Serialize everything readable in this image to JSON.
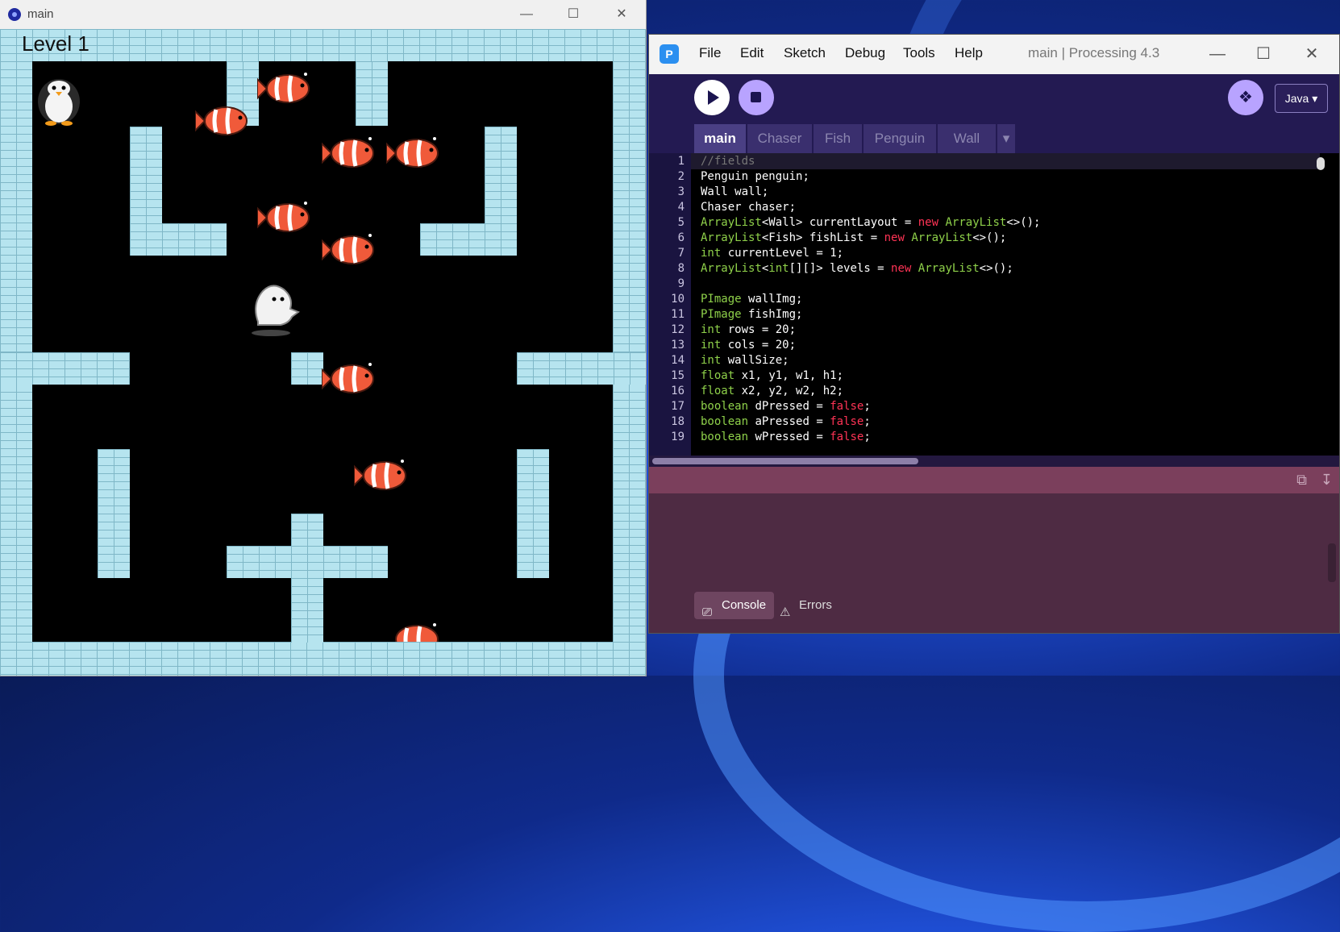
{
  "game": {
    "window_title": "main",
    "level_label": "Level 1"
  },
  "ide": {
    "window_title": "main | Processing 4.3",
    "menu": [
      "File",
      "Edit",
      "Sketch",
      "Debug",
      "Tools",
      "Help"
    ],
    "mode": "Java ▾",
    "tabs": [
      "main",
      "Chaser",
      "Fish",
      "Penguin",
      "Wall"
    ],
    "active_tab": "main",
    "tab_menu_glyph": "▾",
    "code_lines": [
      "//fields",
      "Penguin penguin;",
      "Wall wall;",
      "Chaser chaser;",
      "ArrayList<Wall> currentLayout = new ArrayList<>();",
      "ArrayList<Fish> fishList = new ArrayList<>();",
      "int currentLevel = 1;",
      "ArrayList<int[][]> levels = new ArrayList<>();",
      "",
      "PImage wallImg;",
      "PImage fishImg;",
      "int rows = 20;",
      "int cols = 20;",
      "int wallSize;",
      "float x1, y1, w1, h1;",
      "float x2, y2, w2, h2;",
      "boolean dPressed = false;",
      "boolean aPressed = false;",
      "boolean wPressed = false;"
    ],
    "line_numbers": [
      "1",
      "2",
      "3",
      "4",
      "5",
      "6",
      "7",
      "8",
      "9",
      "10",
      "11",
      "12",
      "13",
      "14",
      "15",
      "16",
      "17",
      "18",
      "19"
    ],
    "console_tab": "Console",
    "errors_tab": "Errors"
  }
}
